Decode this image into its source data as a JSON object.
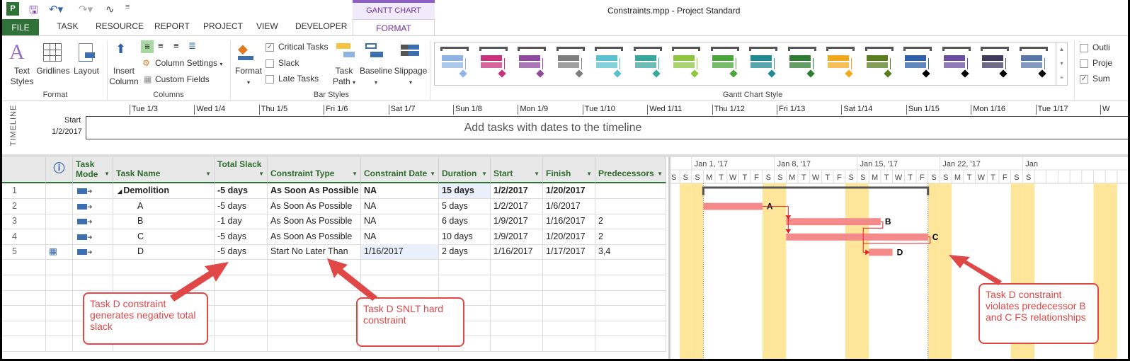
{
  "window": {
    "title": "Constraints.mpp - Project Standard",
    "context_tab": "GANTT CHART TOOLS"
  },
  "tabs": [
    "FILE",
    "TASK",
    "RESOURCE",
    "REPORT",
    "PROJECT",
    "VIEW",
    "DEVELOPER",
    "FORMAT"
  ],
  "ribbon": {
    "format_group": {
      "label": "Format",
      "text_styles": "Text Styles",
      "gridlines": "Gridlines",
      "layout": "Layout"
    },
    "columns_group": {
      "label": "Columns",
      "insert_column": "Insert Column",
      "column_settings": "Column Settings",
      "custom_fields": "Custom Fields"
    },
    "bar_styles_group": {
      "label": "Bar Styles",
      "format": "Format",
      "critical_tasks": "Critical Tasks",
      "slack": "Slack",
      "late_tasks": "Late Tasks",
      "task_path": "Task Path",
      "baseline": "Baseline",
      "slippage": "Slippage",
      "critical_checked": true,
      "slack_checked": false,
      "late_checked": false
    },
    "gantt_style_group": {
      "label": "Gantt Chart Style",
      "colors": [
        "#8fb4e3",
        "#c8327d",
        "#8e4a9e",
        "#7f7f7f",
        "#5bc0cf",
        "#39a89c",
        "#8dc63f",
        "#4aa53a",
        "#1e8a92",
        "#2e7d32",
        "#f2a81d",
        "#5a7d1e",
        "#2e5fa8",
        "#6c4ea0",
        "#3f3a5e",
        "#5878a8"
      ]
    },
    "show_hide_group": {
      "outline": "Outli",
      "project": "Proje",
      "summary": "Sum",
      "outline_checked": false,
      "project_checked": false,
      "summary_checked": true
    }
  },
  "timeline": {
    "side_label": "TIMELINE",
    "start_label": "Start",
    "start_date": "1/2/2017",
    "placeholder": "Add tasks with dates to the timeline",
    "ticks": [
      "Tue 1/3",
      "Wed 1/4",
      "Thu 1/5",
      "Fri 1/6",
      "Sat 1/7",
      "Sun 1/8",
      "Mon 1/9",
      "Tue 1/10",
      "Wed 1/11",
      "Thu 1/12",
      "Fri 1/13",
      "Sat 1/14",
      "Sun 1/15",
      "Mon 1/16",
      "Tue 1/17",
      "W"
    ]
  },
  "table": {
    "columns": [
      "Task Mode",
      "Task Name",
      "Total Slack",
      "Constraint Type",
      "Constraint Date",
      "Duration",
      "Start",
      "Finish",
      "Predecessors"
    ],
    "rows": [
      {
        "id": "1",
        "name": "Demolition",
        "summary": true,
        "slack": "-5 days",
        "ctype": "As Soon As Possible",
        "cdate": "NA",
        "duration": "15 days",
        "start": "1/2/2017",
        "finish": "1/20/2017",
        "pred": ""
      },
      {
        "id": "2",
        "name": "A",
        "slack": "-5 days",
        "ctype": "As Soon As Possible",
        "cdate": "NA",
        "duration": "5 days",
        "start": "1/2/2017",
        "finish": "1/6/2017",
        "pred": ""
      },
      {
        "id": "3",
        "name": "B",
        "slack": "-1 day",
        "ctype": "As Soon As Possible",
        "cdate": "NA",
        "duration": "6 days",
        "start": "1/9/2017",
        "finish": "1/16/2017",
        "pred": "2"
      },
      {
        "id": "4",
        "name": "C",
        "slack": "-5 days",
        "ctype": "As Soon As Possible",
        "cdate": "NA",
        "duration": "10 days",
        "start": "1/9/2017",
        "finish": "1/20/2017",
        "pred": "2"
      },
      {
        "id": "5",
        "name": "D",
        "slack": "-5 days",
        "ctype": "Start No Later Than",
        "cdate": "1/16/2017",
        "duration": "2 days",
        "start": "1/16/2017",
        "finish": "1/17/2017",
        "pred": "3,4",
        "constraint_icon": true
      }
    ]
  },
  "gantt": {
    "weeks": [
      "Jan 1, '17",
      "Jan 8, '17",
      "Jan 15, '17",
      "Jan 22, '17",
      "Jan"
    ],
    "days": [
      "S",
      "S",
      "M",
      "T",
      "W",
      "T",
      "F",
      "S",
      "S",
      "M",
      "T",
      "W",
      "T",
      "F",
      "S",
      "S",
      "M",
      "T",
      "W",
      "T",
      "F",
      "S",
      "S",
      "M",
      "T",
      "W",
      "T",
      "F",
      "S",
      "S"
    ],
    "bar_color": "#f48a8a",
    "link_color": "#e02020",
    "weekend_color": "#fde59a"
  },
  "callouts": [
    "Task D constraint generates negative total slack",
    "Task D SNLT hard constraint",
    "Task D constraint violates predecessor B and C FS relationships"
  ]
}
